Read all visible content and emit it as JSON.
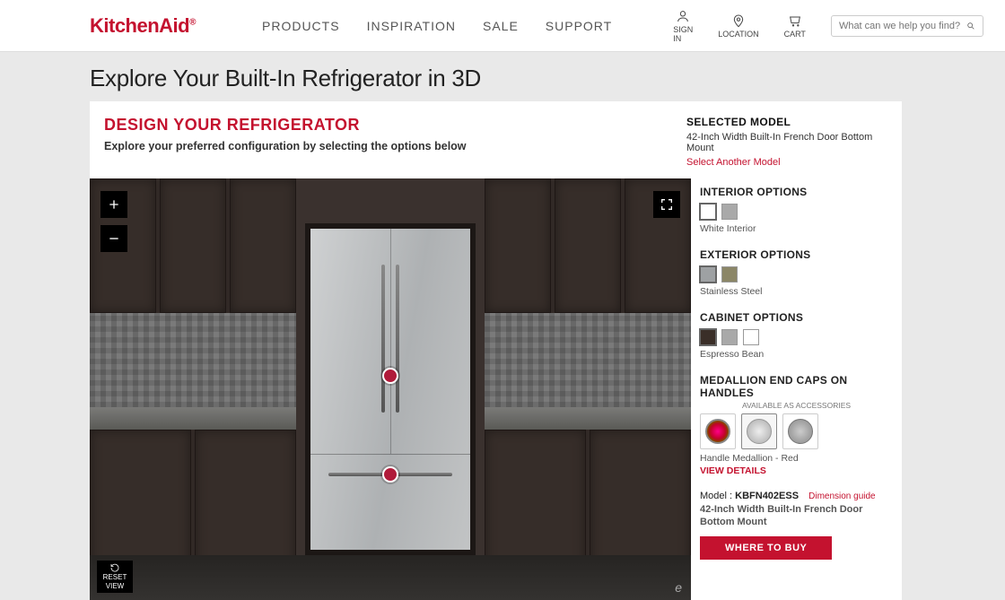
{
  "brand": "KitchenAid",
  "nav": {
    "links": [
      "PRODUCTS",
      "INSPIRATION",
      "SALE",
      "SUPPORT"
    ],
    "signin": "SIGN IN",
    "location": "LOCATION",
    "cart": "CART",
    "search_placeholder": "What can we help you find?"
  },
  "page_title": "Explore Your Built-In Refrigerator in 3D",
  "designer": {
    "heading": "DESIGN YOUR REFRIGERATOR",
    "sub": "Explore your preferred configuration by selecting the options below"
  },
  "selected": {
    "heading": "SELECTED MODEL",
    "desc": "42-Inch Width Built-In French Door Bottom Mount",
    "link": "Select Another Model"
  },
  "viewer": {
    "reset_l1": "RESET",
    "reset_l2": "VIEW"
  },
  "opts": {
    "interior_h": "INTERIOR OPTIONS",
    "interior_sel": "White Interior",
    "exterior_h": "EXTERIOR OPTIONS",
    "exterior_sel": "Stainless Steel",
    "cabinet_h": "CABINET OPTIONS",
    "cabinet_sel": "Espresso Bean",
    "medallion_h": "MEDALLION END CAPS ON HANDLES",
    "medallion_note": "AVAILABLE AS ACCESSORIES",
    "medallion_sel": "Handle Medallion - Red",
    "view_details": "VIEW DETAILS"
  },
  "model": {
    "label": "Model :",
    "sku": "KBFN402ESS",
    "dim": "Dimension guide",
    "desc": "42-Inch Width Built-In French Door Bottom Mount",
    "buy": "WHERE TO BUY"
  }
}
